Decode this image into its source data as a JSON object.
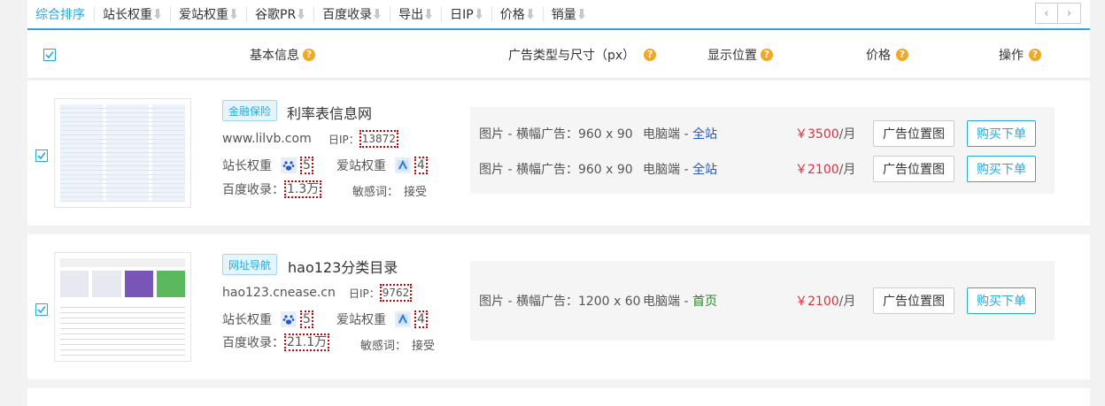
{
  "sortbar": {
    "items": [
      "综合排序",
      "站长权重",
      "爱站权重",
      "谷歌PR",
      "百度收录",
      "导出",
      "日IP",
      "价格",
      "销量"
    ],
    "prev": "‹",
    "next": "›",
    "accent": "#29a8e0"
  },
  "header": {
    "basic": "基本信息",
    "adtype": "广告类型与尺寸（px）",
    "position": "显示位置",
    "price": "价格",
    "action": "操作",
    "help": "?"
  },
  "listings": [
    {
      "tag": "金融保险",
      "name": "利率表信息网",
      "url": "www.lilvb.com",
      "ip_label": "日IP：",
      "ip": "13872",
      "zz_label": "站长权重",
      "zz": "5",
      "az_label": "爱站权重",
      "az": "4",
      "bd_label": "百度收录：",
      "bd": "1.3万",
      "sens_label": "敏感词：",
      "sens": "接受",
      "ads": [
        {
          "desc": "图片 - 横幅广告：960 x 90",
          "platform": "电脑端 - ",
          "pos": "全站",
          "price": "￥3500",
          "unit": "/月",
          "map": "广告位置图",
          "buy": "购买下单"
        },
        {
          "desc": "图片 - 横幅广告：960 x 90",
          "platform": "电脑端 - ",
          "pos": "全站",
          "price": "￥2100",
          "unit": "/月",
          "map": "广告位置图",
          "buy": "购买下单"
        }
      ]
    },
    {
      "tag": "网址导航",
      "name": "hao123分类目录",
      "url": "hao123.cnease.cn",
      "ip_label": "日IP：",
      "ip": "9762",
      "zz_label": "站长权重",
      "zz": "5",
      "az_label": "爱站权重",
      "az": "4",
      "bd_label": "百度收录：",
      "bd": "21.1万",
      "sens_label": "敏感词：",
      "sens": "接受",
      "ads": [
        {
          "desc": "图片 - 横幅广告：1200 x 60",
          "platform": "电脑端 - ",
          "pos": "首页",
          "price": "￥2100",
          "unit": "/月",
          "map": "广告位置图",
          "buy": "购买下单"
        }
      ]
    }
  ]
}
